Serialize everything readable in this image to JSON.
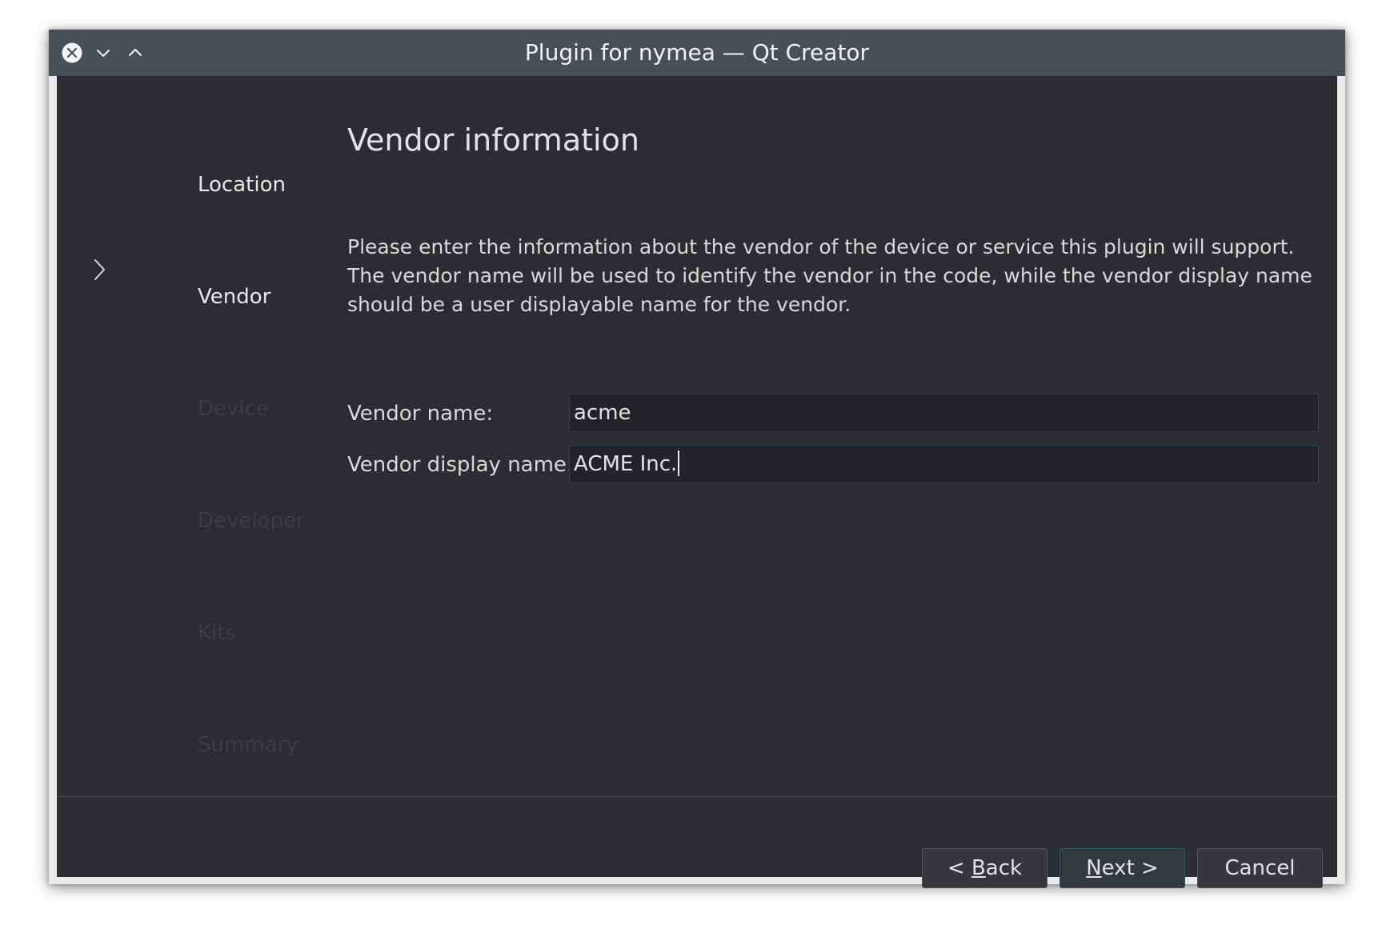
{
  "window": {
    "title": "Plugin for nymea — Qt Creator"
  },
  "wizard_steps": {
    "items": [
      {
        "label": "Location",
        "state": "done"
      },
      {
        "label": "Vendor",
        "state": "current"
      },
      {
        "label": "Device",
        "state": "pending"
      },
      {
        "label": "Developer",
        "state": "pending"
      },
      {
        "label": "Kits",
        "state": "pending"
      },
      {
        "label": "Summary",
        "state": "pending"
      }
    ]
  },
  "page": {
    "title": "Vendor information",
    "description": "Please enter the information about the vendor of the device or service this plugin will support. The vendor name will be used to identify the vendor in the code, while the vendor display name should be a user displayable name for the vendor."
  },
  "form": {
    "vendor_name_label": "Vendor name:",
    "vendor_name_value": "acme",
    "vendor_display_name_label": "Vendor display name:",
    "vendor_display_name_value": "ACME Inc."
  },
  "buttons": {
    "back": {
      "prefix": "< ",
      "mnemonic": "B",
      "rest": "ack"
    },
    "next": {
      "mnemonic": "N",
      "rest": "ext >"
    },
    "cancel": "Cancel"
  },
  "colors": {
    "titlebar": "#475057",
    "content_bg": "#2c2d30",
    "focus_border": "#1f4a57"
  }
}
